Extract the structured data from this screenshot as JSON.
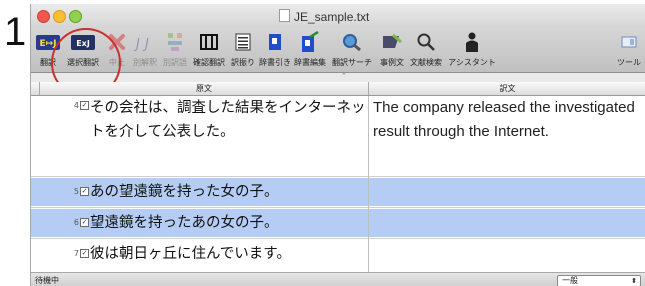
{
  "step_number": "1",
  "window": {
    "title": "JE_sample.txt"
  },
  "toolbar": {
    "items": [
      {
        "label": "翻訳",
        "icon": "translate-icon"
      },
      {
        "label": "選択翻訳",
        "icon": "selected-translate-icon"
      },
      {
        "label": "中止",
        "icon": "stop-icon"
      },
      {
        "label": "別解釈",
        "icon": "alternative-interpretation-icon"
      },
      {
        "label": "別訳語",
        "icon": "alternative-word-icon"
      },
      {
        "label": "確認翻訳",
        "icon": "confirm-translate-icon"
      },
      {
        "label": "訳振り",
        "icon": "interlinear-icon"
      },
      {
        "label": "辞書引き",
        "icon": "dictionary-lookup-icon"
      },
      {
        "label": "辞書編集",
        "icon": "dictionary-edit-icon"
      },
      {
        "label": "翻訳サーチ",
        "icon": "translation-search-icon"
      },
      {
        "label": "事例文",
        "icon": "example-sentence-icon"
      },
      {
        "label": "文献検索",
        "icon": "literature-search-icon"
      },
      {
        "label": "アシスタント",
        "icon": "assistant-icon"
      },
      {
        "label": "ツール",
        "icon": "tools-icon"
      }
    ],
    "icon_text": {
      "translate": "E↦J",
      "selected": "ExJ"
    },
    "highlight_color": "#c9302c"
  },
  "columns": {
    "source": "原文",
    "target": "訳文"
  },
  "rows": [
    {
      "num": "4",
      "checked": true,
      "source": "その会社は、調査した結果をインターネットを介して公表した。",
      "target": "The company released the investigated result through the Internet."
    },
    {
      "num": "5",
      "checked": true,
      "source": "あの望遠鏡を持った女の子。",
      "target": ""
    },
    {
      "num": "6",
      "checked": true,
      "source": "望遠鏡を持ったあの女の子。",
      "target": ""
    },
    {
      "num": "7",
      "checked": true,
      "source": "彼は朝日ヶ丘に住んでいます。",
      "target": ""
    }
  ],
  "status": {
    "text": "待機中",
    "mode_select": "一般",
    "selection_color": "#b5cdf5"
  }
}
